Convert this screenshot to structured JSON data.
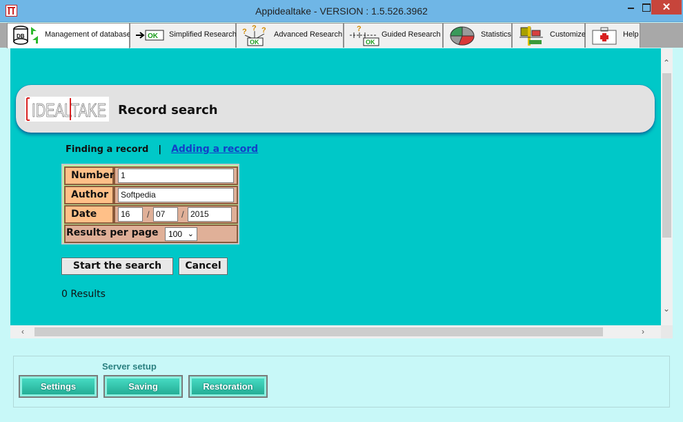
{
  "window": {
    "title": "Appidealtake - VERSION : 1.5.526.3962"
  },
  "tabs": [
    {
      "label": "Management of database",
      "icon": "database-icon",
      "active": true
    },
    {
      "label": "Simplified Research",
      "icon": "ok-arrow-icon",
      "active": false
    },
    {
      "label": "Advanced Research",
      "icon": "question-ok-icon",
      "active": false
    },
    {
      "label": "Guided Research",
      "icon": "guided-ok-icon",
      "active": false
    },
    {
      "label": "Statistics",
      "icon": "pie-chart-icon",
      "active": false
    },
    {
      "label": "Customize",
      "icon": "tools-icon",
      "active": false
    },
    {
      "label": "Help",
      "icon": "first-aid-icon",
      "active": false
    }
  ],
  "banner": {
    "title": "Record search",
    "logo_text": "IDEALTAKE"
  },
  "subnav": {
    "current": "Finding a record",
    "separator": "|",
    "link": "Adding a record"
  },
  "form": {
    "number_label": "Number",
    "number_value": "1",
    "author_label": "Author",
    "author_value": "Softpedia",
    "date_label": "Date",
    "date_day": "16",
    "date_month": "07",
    "date_year": "2015",
    "date_sep": "/",
    "results_label": "Results per page",
    "results_value": "100"
  },
  "actions": {
    "start": "Start the search",
    "cancel": "Cancel"
  },
  "results_text": "0 Results",
  "server": {
    "label": "Server setup",
    "settings": "Settings",
    "saving": "Saving",
    "restoration": "Restoration"
  },
  "colors": {
    "content_bg": "#00c8c8",
    "panel_bg": "#c8f8f8",
    "label_bg": "#ffc088",
    "link": "#1240c8"
  }
}
